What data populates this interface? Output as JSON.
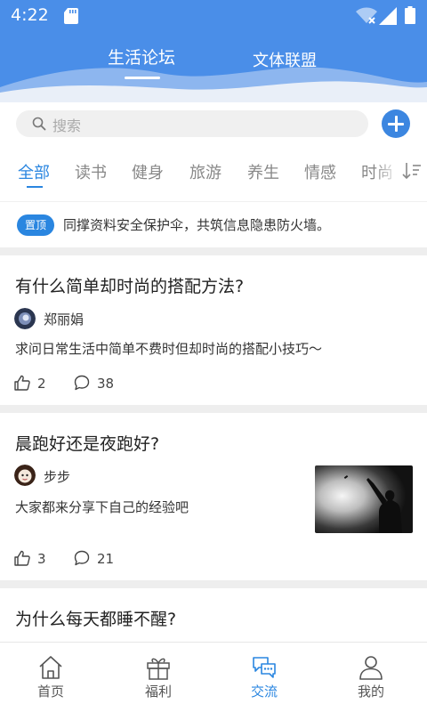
{
  "status_bar": {
    "time": "4:22"
  },
  "top_tabs": [
    {
      "label": "生活论坛",
      "active": true
    },
    {
      "label": "文体联盟",
      "active": false
    }
  ],
  "search": {
    "placeholder": "搜索"
  },
  "categories": [
    "全部",
    "读书",
    "健身",
    "旅游",
    "养生",
    "情感",
    "时尚"
  ],
  "active_category": "全部",
  "pinned": {
    "badge": "置顶",
    "text": "同撑资料安全保护伞，共筑信息隐患防火墙。"
  },
  "posts": [
    {
      "title": "有什么简单却时尚的搭配方法?",
      "author": "郑丽娟",
      "excerpt": "求问日常生活中简单不费时但却时尚的搭配小技巧～",
      "likes": "2",
      "comments": "38"
    },
    {
      "title": "晨跑好还是夜跑好?",
      "author": "步步",
      "excerpt": "大家都来分享下自己的经验吧",
      "likes": "3",
      "comments": "21"
    },
    {
      "title": "为什么每天都睡不醒?"
    }
  ],
  "bottom_nav": [
    {
      "label": "首页",
      "icon": "home-icon"
    },
    {
      "label": "福利",
      "icon": "gift-icon"
    },
    {
      "label": "交流",
      "icon": "chat-icon",
      "active": true
    },
    {
      "label": "我的",
      "icon": "user-icon"
    }
  ],
  "colors": {
    "header_blue": "#4a8ee8",
    "accent": "#2a86e0"
  }
}
